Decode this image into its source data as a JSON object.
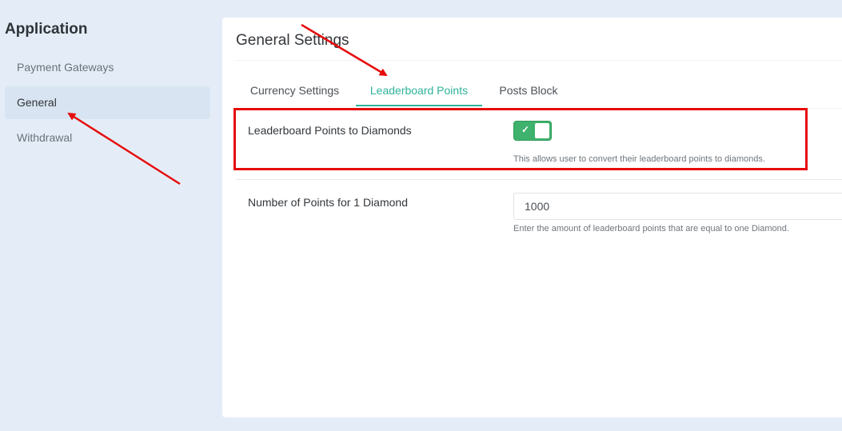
{
  "sidebar": {
    "title": "Application",
    "items": [
      {
        "label": "Payment Gateways"
      },
      {
        "label": "General"
      },
      {
        "label": "Withdrawal"
      }
    ]
  },
  "panel": {
    "title": "General Settings",
    "tabs": [
      {
        "label": "Currency Settings"
      },
      {
        "label": "Leaderboard Points"
      },
      {
        "label": "Posts Block"
      }
    ],
    "active_tab": "Leaderboard Points"
  },
  "fields": {
    "toggle": {
      "label": "Leaderboard Points to Diamonds",
      "checked": true,
      "help": "This allows user to convert their leaderboard points to diamonds."
    },
    "points": {
      "label": "Number of Points for 1 Diamond",
      "value": "1000",
      "help": "Enter the amount of leaderboard points that are equal to one Diamond."
    }
  },
  "annotations": {
    "color": "#e60c0c"
  },
  "colors": {
    "accent": "#2fb39a",
    "toggle_on": "#3fb26d",
    "background": "#e4edf7"
  }
}
